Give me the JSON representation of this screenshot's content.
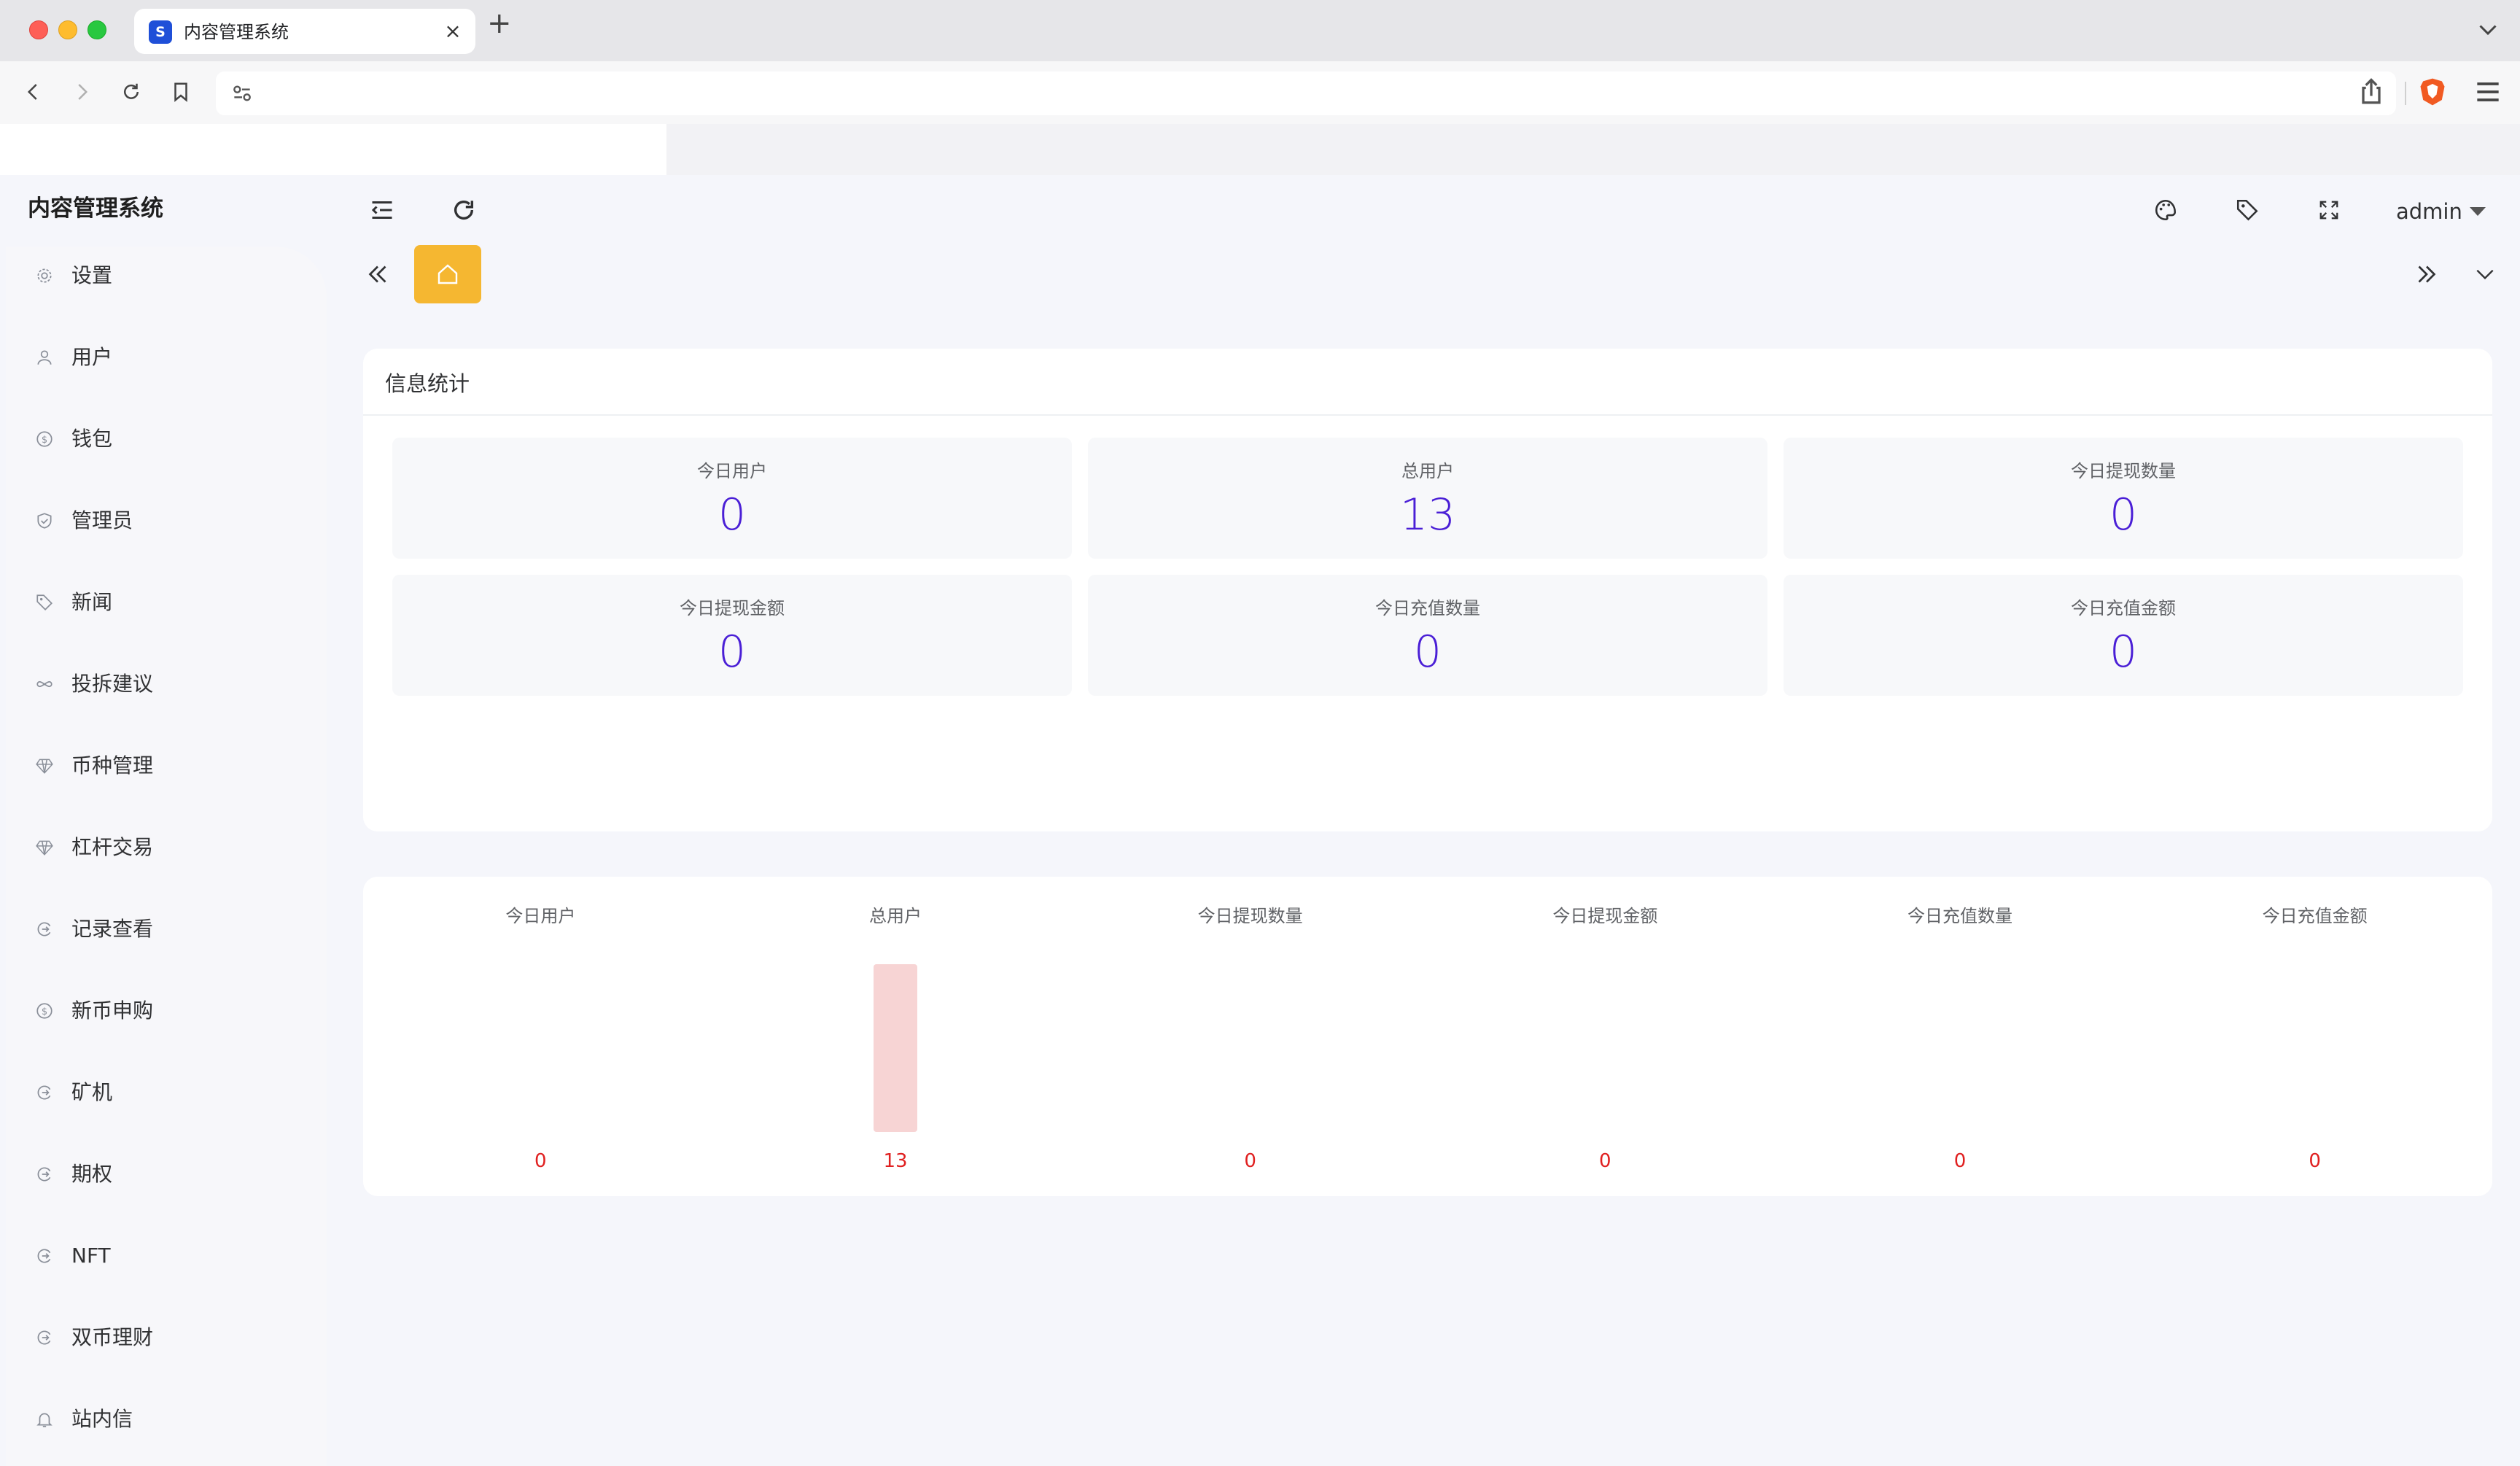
{
  "browser": {
    "tab_title": "内容管理系统",
    "favicon_glyph": "S",
    "url": ""
  },
  "app": {
    "title": "内容管理系统"
  },
  "sidebar": {
    "items": [
      {
        "label": "设置",
        "icon": "gear-icon"
      },
      {
        "label": "用户",
        "icon": "user-icon"
      },
      {
        "label": "钱包",
        "icon": "dollar-coin-icon"
      },
      {
        "label": "管理员",
        "icon": "shield-check-icon"
      },
      {
        "label": "新闻",
        "icon": "tag-icon"
      },
      {
        "label": "投拆建议",
        "icon": "infinity-link-icon"
      },
      {
        "label": "币种管理",
        "icon": "diamond-icon"
      },
      {
        "label": "杠杆交易",
        "icon": "diamond-icon"
      },
      {
        "label": "记录查看",
        "icon": "circle-arrow-icon"
      },
      {
        "label": "新币申购",
        "icon": "dollar-coin-icon"
      },
      {
        "label": "矿机",
        "icon": "circle-arrow-icon"
      },
      {
        "label": "期权",
        "icon": "circle-arrow-icon"
      },
      {
        "label": "NFT",
        "icon": "circle-arrow-icon"
      },
      {
        "label": "双币理财",
        "icon": "circle-arrow-icon"
      },
      {
        "label": "站内信",
        "icon": "bell-icon"
      }
    ]
  },
  "header": {
    "user": "admin",
    "icons": [
      "collapse-menu-icon",
      "refresh-icon",
      "palette-icon",
      "tag-icon",
      "fullscreen-icon"
    ]
  },
  "tabs": {
    "home_icon": "home-icon",
    "accent": "#f5b731"
  },
  "stats": {
    "title": "信息统计",
    "items": [
      {
        "label": "今日用户",
        "value": "0"
      },
      {
        "label": "总用户",
        "value": "13"
      },
      {
        "label": "今日提现数量",
        "value": "0"
      },
      {
        "label": "今日提现金额",
        "value": "0"
      },
      {
        "label": "今日充值数量",
        "value": "0"
      },
      {
        "label": "今日充值金额",
        "value": "0"
      }
    ],
    "value_color": "#4a1fd6"
  },
  "chart_data": {
    "type": "bar",
    "categories": [
      "今日用户",
      "总用户",
      "今日提现数量",
      "今日提现金额",
      "今日充值数量",
      "今日充值金额"
    ],
    "values": [
      0,
      13,
      0,
      0,
      0,
      0
    ],
    "ylim": [
      0,
      13
    ],
    "bar_color": "#f7d4d4",
    "label_color": "#e02020",
    "grid": false
  }
}
